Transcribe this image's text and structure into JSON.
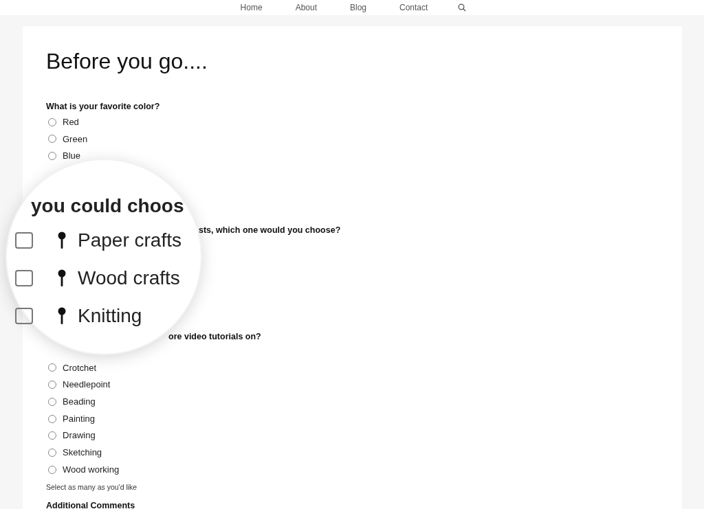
{
  "nav": {
    "items": [
      {
        "label": "Home"
      },
      {
        "label": "About"
      },
      {
        "label": "Blog"
      },
      {
        "label": "Contact"
      }
    ]
  },
  "page_title": "Before you go....",
  "questions": [
    {
      "label": "What is your favorite color?",
      "options": [
        {
          "label": "Red",
          "selected": false
        },
        {
          "label": "Green",
          "selected": false
        },
        {
          "label": "Blue",
          "selected": false
        }
      ]
    },
    {
      "label": "sts, which one would you choose?"
    },
    {
      "label": "ore video tutorials on?",
      "options": [
        {
          "label": "Crotchet",
          "selected": false
        },
        {
          "label": "Needlepoint",
          "selected": false
        },
        {
          "label": "Beading",
          "selected": false
        },
        {
          "label": "Painting",
          "selected": false
        },
        {
          "label": "Drawing",
          "selected": false
        },
        {
          "label": "Sketching",
          "selected": false
        },
        {
          "label": "Wood working",
          "selected": false
        }
      ],
      "help": "Select as many as you'd like"
    },
    {
      "label": "Additional Comments"
    }
  ],
  "magnifier": {
    "heading": "you could choos",
    "items": [
      {
        "label": "Paper crafts",
        "checked": false
      },
      {
        "label": "Wood crafts",
        "checked": false
      },
      {
        "label": "Knitting",
        "checked": false
      }
    ]
  }
}
